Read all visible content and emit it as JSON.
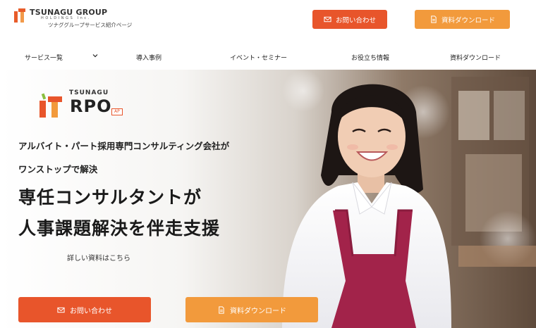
{
  "header": {
    "logo": {
      "name": "TSUNAGU GROUP",
      "sub": "HOLDINGS Inc.",
      "caption": "ツナググループサービス紹介ページ"
    },
    "contact_label": "お問い合わせ",
    "download_label": "資料ダウンロード"
  },
  "nav": {
    "items": [
      "サービス一覧",
      "導入事例",
      "イベント・セミナー",
      "お役立ち情報",
      "資料ダウンロード"
    ]
  },
  "hero": {
    "product_logo": {
      "small": "TSUNAGU",
      "big": "RPO",
      "badge": "AP"
    },
    "lead_line1": "アルバイト・パート採用専門コンサルティング会社が",
    "lead_line2": "ワンストップで解決",
    "headline_line1": "専任コンサルタントが",
    "headline_line2": "人事課題解決を伴走支援",
    "detail_link": "詳しい資料はこちら",
    "cta_contact_label": "お問い合わせ",
    "cta_download_label": "資料ダウンロード"
  },
  "colors": {
    "accent_orange_red": "#e8552b",
    "accent_orange": "#f29a3c",
    "apron": "#a2234a"
  },
  "icons": {
    "contact": "mail-icon",
    "download": "document-icon",
    "nav_dropdown": "chevron-down-icon"
  }
}
